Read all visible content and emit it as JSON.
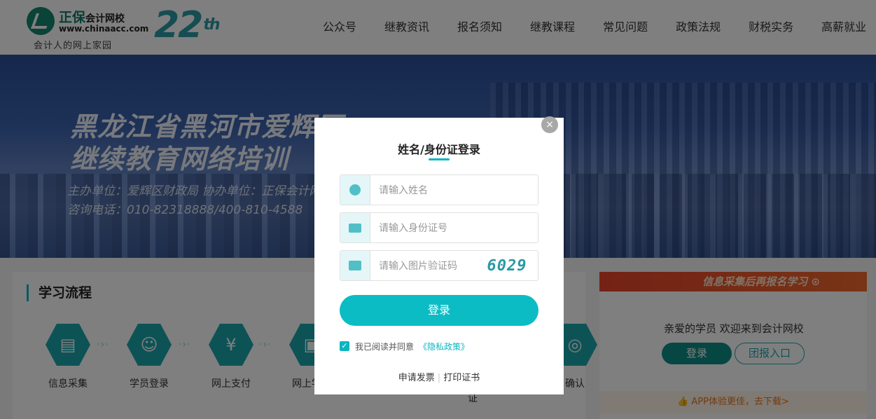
{
  "header": {
    "brand_main": "正保",
    "brand_sub": "会计网校",
    "url": "www.chinaacc.com",
    "slogan": "会计人的网上家园",
    "anniversary": "22",
    "anniversary_suffix": "th",
    "nav": [
      "公众号",
      "继教资讯",
      "报名须知",
      "继教课程",
      "常见问题",
      "政策法规",
      "财税实务",
      "高薪就业"
    ]
  },
  "banner": {
    "title_line1": "黑龙江省黑河市爱辉区",
    "title_line2": "继续教育网络培训",
    "sub_line1": "主办单位：爱辉区财政局  协办单位：正保会计网校",
    "sub_line2": "咨询电话：010-82318888/400-810-4588"
  },
  "flow": {
    "title": "学习流程",
    "steps": [
      {
        "label": "信息采集",
        "icon": "clipboard-icon"
      },
      {
        "label": "学员登录",
        "icon": "user-check-icon"
      },
      {
        "label": "网上支付",
        "icon": "money-bag-icon"
      },
      {
        "label": "网上学习",
        "icon": "id-card-icon"
      }
    ],
    "hidden_tail_1": "证",
    "hidden_tail_2": "确认"
  },
  "side": {
    "banner_text": "信息采集后再报名学习",
    "welcome": "亲爱的学员 欢迎来到会计网校",
    "login_label": "登录",
    "group_label": "团报入口",
    "app_text": "APP体验更佳，去下载>"
  },
  "modal": {
    "title": "姓名/身份证登录",
    "name_placeholder": "请输入姓名",
    "id_placeholder": "请输入身份证号",
    "captcha_placeholder": "请输入图片验证码",
    "captcha_code": "6029",
    "login_label": "登录",
    "agree_text": "我已阅读并同意",
    "agree_link": "《隐私政策》",
    "invoice_link": "申请发票",
    "certificate_link": "打印证书",
    "close_symbol": "×"
  },
  "colors": {
    "accent": "#0bbcc5",
    "brand_green": "#0e7c66",
    "overlay": "rgba(0,0,0,0.5)"
  }
}
